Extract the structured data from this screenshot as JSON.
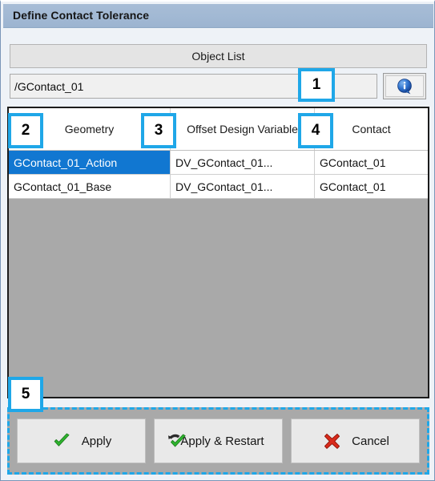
{
  "window": {
    "title": "Define Contact Tolerance"
  },
  "object_list": {
    "header_label": "Object List",
    "path_value": "/GContact_01",
    "path_placeholder": "",
    "info_icon": "info-bubble-icon"
  },
  "table": {
    "columns": [
      "Geometry",
      "Offset Design Variable",
      "Contact"
    ],
    "rows": [
      {
        "geometry": "GContact_01_Action",
        "offset_design_variable": "DV_GContact_01...",
        "contact": "GContact_01",
        "selected": true
      },
      {
        "geometry": "GContact_01_Base",
        "offset_design_variable": "DV_GContact_01...",
        "contact": "GContact_01",
        "selected": false
      }
    ]
  },
  "buttons": {
    "apply": {
      "label": "Apply",
      "icon": "green-check-icon"
    },
    "apply_restart": {
      "label": "Apply & Restart",
      "icon": "green-check-restart-icon"
    },
    "cancel": {
      "label": "Cancel",
      "icon": "red-x-icon"
    }
  },
  "annotations": {
    "badges": [
      {
        "number": "1"
      },
      {
        "number": "2"
      },
      {
        "number": "3"
      },
      {
        "number": "4"
      },
      {
        "number": "5"
      }
    ]
  },
  "colors": {
    "titlebar": "#a2b9d4",
    "selection_blue": "#1177d1",
    "annotation_cyan": "#1fa7e8",
    "panel_gray": "#a9a9a9",
    "check_green": "#2eb52e",
    "cancel_red": "#d92b1c",
    "info_blue": "#1f63c4"
  }
}
